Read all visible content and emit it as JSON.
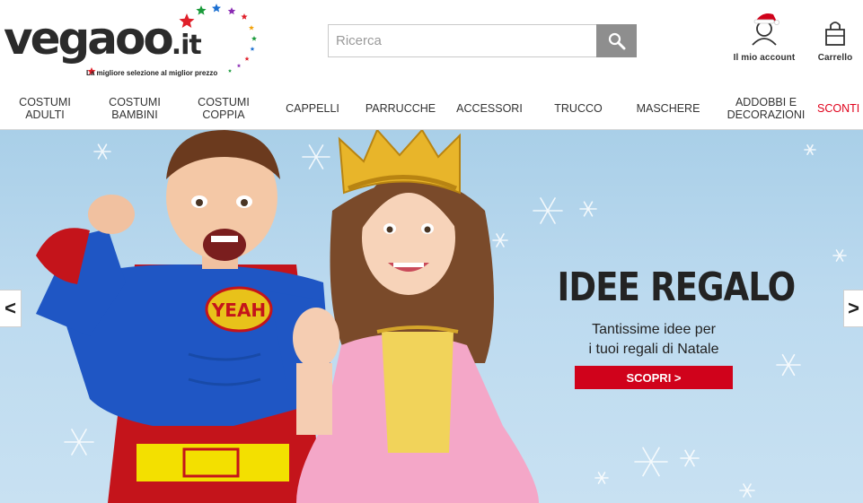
{
  "logo": {
    "word": "vegaoo",
    "tld": ".it",
    "tagline": "La migliore selezione al miglior prezzo"
  },
  "search": {
    "placeholder": "Ricerca",
    "value": "",
    "icon": "magnifier-icon"
  },
  "header": {
    "account_label": "Il mio account",
    "cart_label": "Carrello"
  },
  "nav": {
    "items": [
      {
        "label": "COSTUMI\nADULTI"
      },
      {
        "label": "COSTUMI\nBAMBINI"
      },
      {
        "label": "COSTUMI\nCOPPIA"
      },
      {
        "label": "CAPPELLI"
      },
      {
        "label": "PARRUCCHE"
      },
      {
        "label": "ACCESSORI"
      },
      {
        "label": "TRUCCO"
      },
      {
        "label": "MASCHERE"
      },
      {
        "label": "ADDOBBI E\nDECORAZIONI"
      },
      {
        "label": "SCONTI"
      }
    ]
  },
  "banner": {
    "title": "IDEE REGALO",
    "subtitle_line1": "Tantissime idee per",
    "subtitle_line2": "i tuoi regali di Natale",
    "button_label": "SCOPRI >",
    "prev_label": "<",
    "next_label": ">",
    "hero_emblem": "YEAH"
  },
  "colors": {
    "accent_red": "#d0021b",
    "sale_red": "#e0001a",
    "search_button": "#8e8e8e",
    "banner_sky": "#b7d7ee"
  }
}
